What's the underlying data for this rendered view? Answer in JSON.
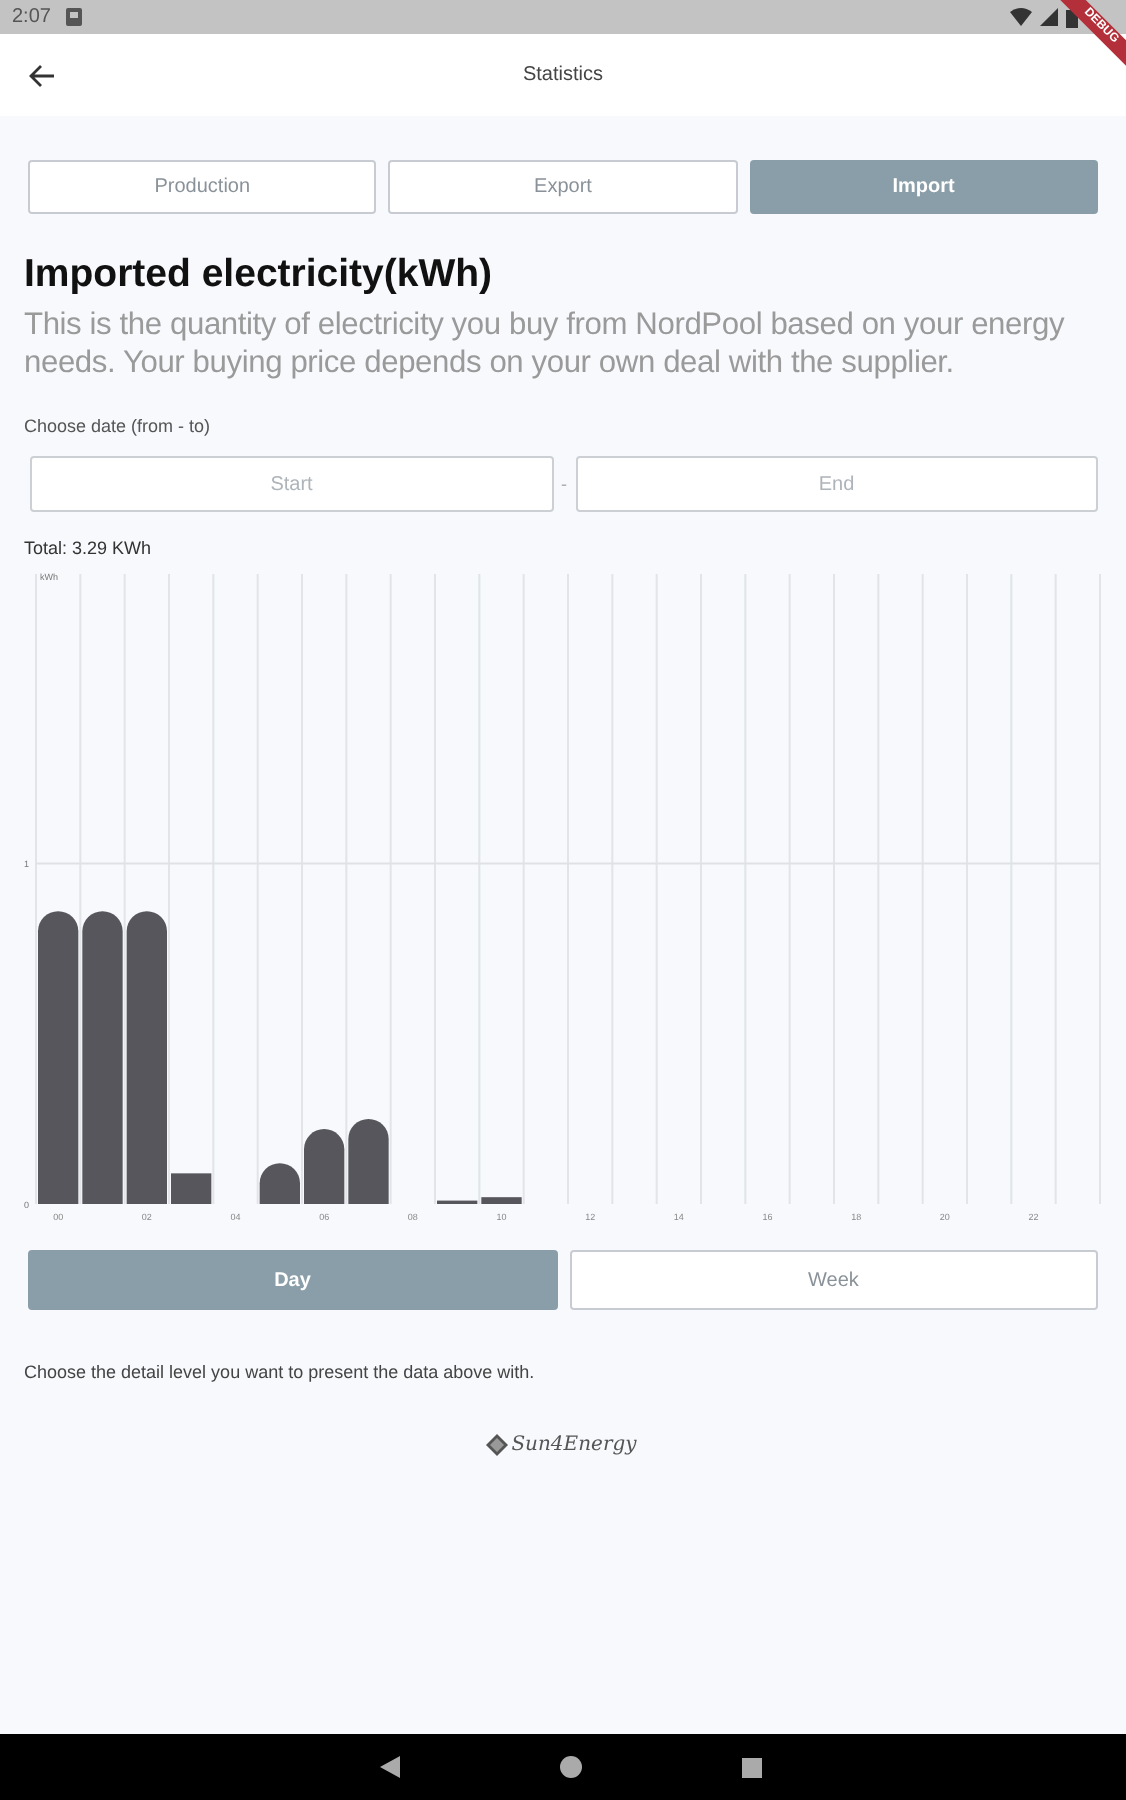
{
  "status_bar": {
    "time": "2:07"
  },
  "debug_banner": "DEBUG",
  "app_bar": {
    "title": "Statistics"
  },
  "tabs": [
    {
      "label": "Production",
      "selected": false
    },
    {
      "label": "Export",
      "selected": false
    },
    {
      "label": "Import",
      "selected": true
    }
  ],
  "heading": "Imported electricity(kWh)",
  "description": "This is the quantity of electricity you buy from NordPool based on your energy needs. Your buying price depends on your own deal with the supplier.",
  "date_range": {
    "label": "Choose date (from - to)",
    "start": {
      "placeholder": "Start"
    },
    "separator": "-",
    "end": {
      "placeholder": "End"
    }
  },
  "total": "Total: 3.29 KWh",
  "chart_data": {
    "type": "bar",
    "ylabel": "kWh",
    "ylim": [
      0,
      1.85
    ],
    "yticks": [
      0,
      1
    ],
    "xlim": [
      -0.5,
      23.5
    ],
    "x": [
      0,
      1,
      2,
      3,
      4,
      5,
      6,
      7,
      8,
      9,
      10
    ],
    "xticks": [
      {
        "value": 0,
        "label": "00"
      },
      {
        "value": 2,
        "label": "02"
      },
      {
        "value": 4,
        "label": "04"
      },
      {
        "value": 6,
        "label": "06"
      },
      {
        "value": 8,
        "label": "08"
      },
      {
        "value": 10,
        "label": "10"
      },
      {
        "value": 12,
        "label": "12"
      },
      {
        "value": 14,
        "label": "14"
      },
      {
        "value": 16,
        "label": "16"
      },
      {
        "value": 18,
        "label": "18"
      },
      {
        "value": 20,
        "label": "20"
      },
      {
        "value": 22,
        "label": "22"
      }
    ],
    "series": [
      {
        "color": "#56565c",
        "values": [
          0.86,
          0.86,
          0.86,
          0.09,
          0,
          0.12,
          0.22,
          0.25,
          0,
          0.01,
          0.02
        ]
      }
    ]
  },
  "period_buttons": [
    {
      "label": "Day",
      "selected": true
    },
    {
      "label": "Week",
      "selected": false
    }
  ],
  "hint": "Choose the detail level you want to present the data above with.",
  "logo": "Sun4Energy"
}
